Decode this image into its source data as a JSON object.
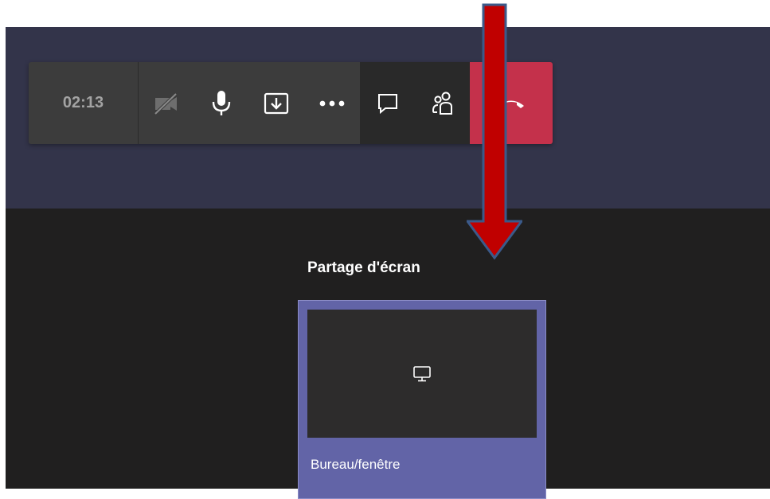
{
  "call_bar": {
    "timer": "02:13",
    "buttons": {
      "camera_icon": "camera-off-icon",
      "mic_icon": "microphone-icon",
      "share_icon": "share-tray-icon",
      "more_icon": "more-options-icon",
      "chat_icon": "chat-icon",
      "participants_icon": "participants-icon",
      "hangup_icon": "hang-up-icon"
    },
    "colors": {
      "hangup": "#c4314b",
      "accent": "#6264a7"
    }
  },
  "share_tray": {
    "heading": "Partage d'écran",
    "tile_label": "Bureau/fenêtre",
    "tile_icon": "monitor-icon"
  },
  "annotation": {
    "arrow_color": "#c00000"
  }
}
